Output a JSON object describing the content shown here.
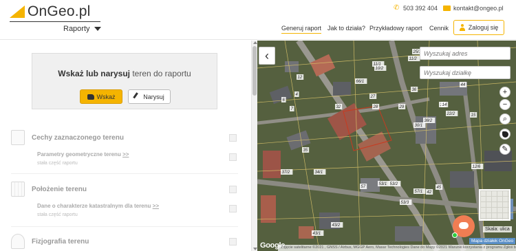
{
  "header": {
    "logo_text": "OnGeo.pl",
    "reports_menu": "Raporty",
    "phone": "503 392 404",
    "email": "kontakt@ongeo.pl",
    "nav": [
      "Generuj raport",
      "Jak to działa?",
      "Przykładowy raport",
      "Cennik"
    ],
    "login_label": "Zaloguj się"
  },
  "left_panel": {
    "draw_title_bold": "Wskaż lub narysuj",
    "draw_title_rest": " teren do raportu",
    "btn_point": "Wskaż",
    "btn_draw": "Narysuj",
    "sections": [
      {
        "title": "Cechy zaznaczonego terenu",
        "sub": "Parametry geometryczne terenu",
        "sub_arrow": ">>",
        "note": "stała część raportu"
      },
      {
        "title": "Położenie terenu",
        "sub": "Dane o charakterze katastralnym dla terenu",
        "sub_arrow": ">>",
        "note": "stała część raportu"
      },
      {
        "title": "Fizjografia terenu"
      }
    ]
  },
  "map": {
    "search_address": "Wyszukaj adres",
    "search_parcel": "Wyszukaj działkę",
    "zoom_in": "+",
    "zoom_out": "−",
    "scale_label": "Skala: ulica",
    "mapa_link": "Mapa działek OnGeo",
    "google_logo": "Google",
    "attribution": "Zdjęcie satelitarne ©2021 , GNSS / Airbus, MGGP Aero, Maxar Technologies   Dane do Mapy ©2021   Warunki korzystania z programu   Zgłoś błąd w mapach",
    "parcel_labels": [
      "25/1",
      "11/2",
      "11/1",
      "10/2",
      "66/1",
      "36",
      "32",
      "27",
      "28",
      "29",
      "30/1",
      "38/2",
      "44",
      "16",
      "22/2",
      "14",
      "15",
      "12/6",
      "57/1",
      "34/1",
      "37/2",
      "35",
      "57",
      "53/2",
      "53/1",
      "53/3",
      "43/2",
      "43/1",
      "45",
      "42",
      "12",
      "6",
      "7",
      "4"
    ]
  },
  "colors": {
    "accent": "#f5b400",
    "chat": "#f07d53"
  }
}
